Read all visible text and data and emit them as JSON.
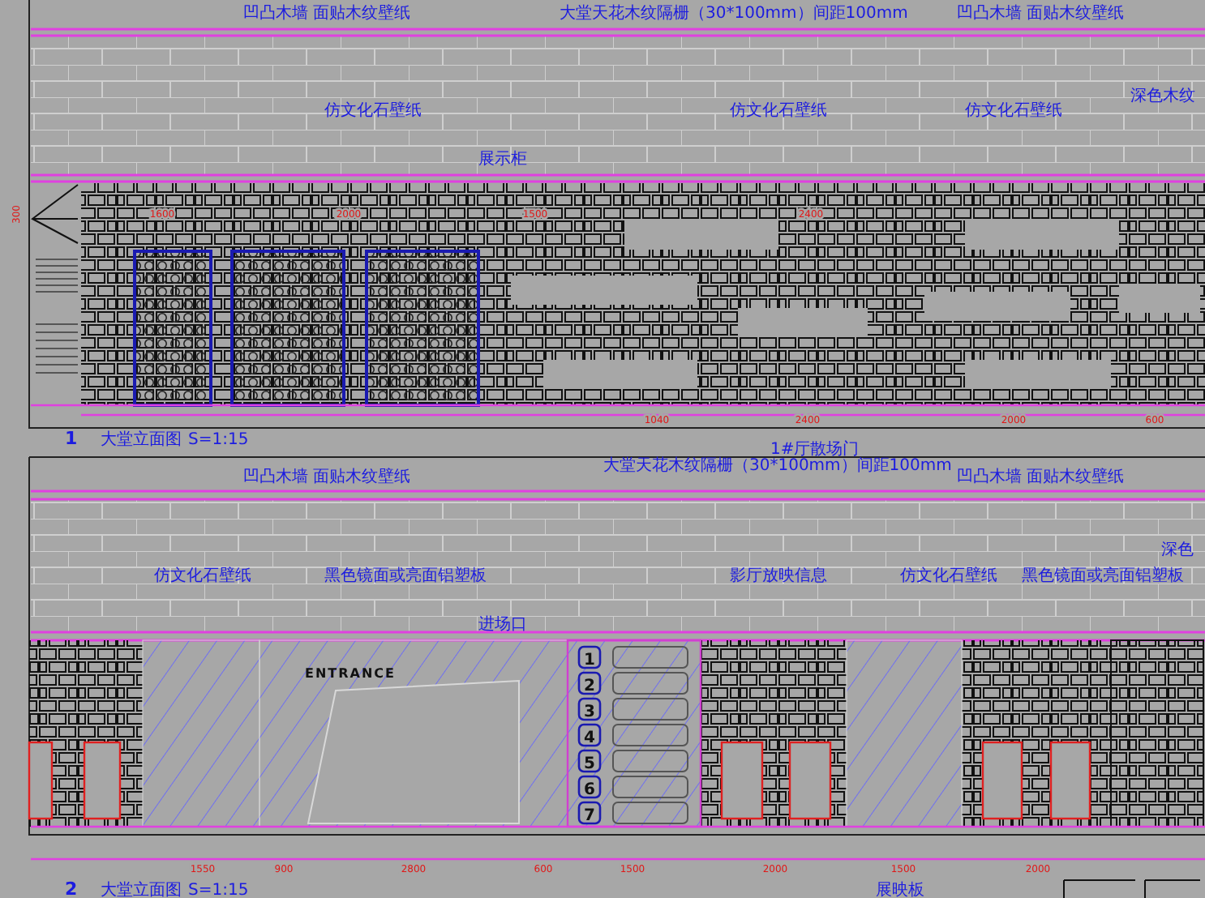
{
  "elevation_1": {
    "labels": [
      "凹凸木墙 面贴木纹壁纸",
      "大堂天花木纹隔栅（30*100mm）间距100mm",
      "凹凸木墙 面贴木纹壁纸",
      "仿文化石壁纸",
      "仿文化石壁纸",
      "仿文化石壁纸",
      "深色木纹",
      "展示柜"
    ],
    "side_dimension": "300",
    "top_dimensions": [
      "1600",
      "2000",
      "1500",
      "2400"
    ],
    "bottom_dimensions": [
      "1040",
      "2400",
      "2000",
      "600"
    ],
    "title_number": "1",
    "title": "大堂立面图",
    "scale": "S=1:15"
  },
  "door_sign": "1#厅散场门",
  "elevation_2": {
    "labels": [
      "凹凸木墙 面贴木纹壁纸",
      "大堂天花木纹隔栅（30*100mm）间距100mm",
      "凹凸木墙 面贴木纹壁纸",
      "深色",
      "仿文化石壁纸",
      "黑色镜面或亮面铝塑板",
      "影厅放映信息",
      "仿文化石壁纸",
      "黑色镜面或亮面铝塑板",
      "进场口"
    ],
    "entrance": "ENTRANCE",
    "screen_numbers": [
      "1",
      "2",
      "3",
      "4",
      "5",
      "6",
      "7"
    ],
    "bottom_dimensions": [
      "1550",
      "900",
      "2800",
      "600",
      "1500",
      "2000",
      "1500",
      "2000"
    ],
    "title_number": "2",
    "title": "大堂立面图",
    "scale": "S=1:15",
    "footer_label": "展映板"
  }
}
